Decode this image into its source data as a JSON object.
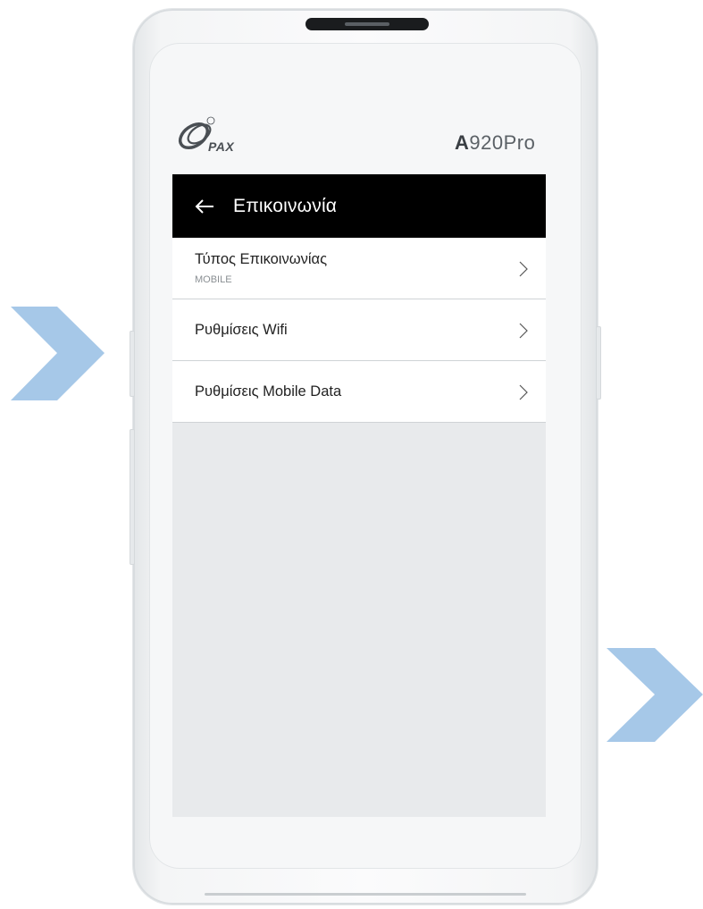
{
  "device": {
    "brand_logo": "PAX",
    "model_prefix": "A",
    "model_suffix": "920Pro"
  },
  "appbar": {
    "back_icon": "arrow-left-icon",
    "title": "Επικοινωνία"
  },
  "menu": {
    "items": [
      {
        "label": "Τύπος Επικοινωνίας",
        "value": "MOBILE"
      },
      {
        "label": "Ρυθμίσεις Wifi"
      },
      {
        "label": "Ρυθμίσεις Mobile Data"
      }
    ]
  },
  "colors": {
    "accent_chevron": "#a6c8e8",
    "appbar_bg": "#000000",
    "screen_bg": "#e8eaec"
  }
}
